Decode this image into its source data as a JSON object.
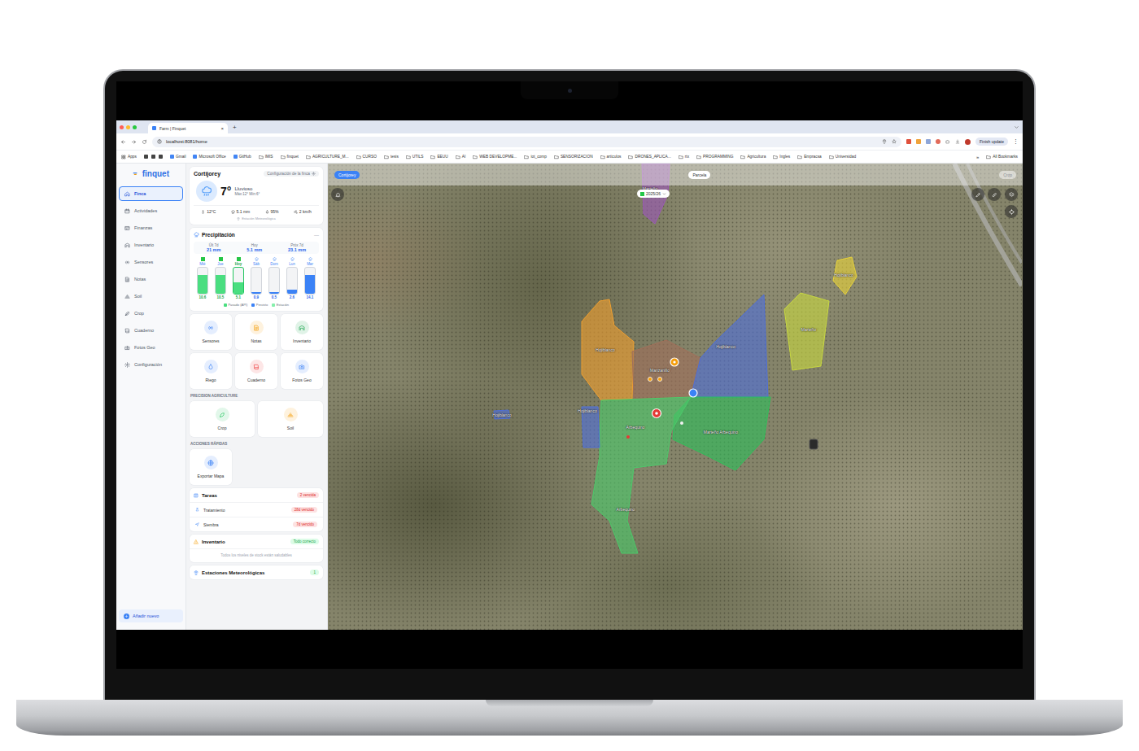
{
  "browser": {
    "tab_title": "Farm | Finquet",
    "tab_close": "×",
    "new_tab": "+",
    "url": "localhost:8081/home",
    "update_button": "Finish update",
    "menu": "⋮",
    "bookmarks": [
      {
        "label": "Apps",
        "kind": "apps"
      },
      {
        "label": "Gmail",
        "kind": "site"
      },
      {
        "label": "Microsoft Office",
        "kind": "site"
      },
      {
        "label": "GitHub",
        "kind": "site"
      },
      {
        "label": "IMIS",
        "kind": "folder"
      },
      {
        "label": "finquet",
        "kind": "folder"
      },
      {
        "label": "AGRICULTURE_M...",
        "kind": "folder"
      },
      {
        "label": "CURSO",
        "kind": "folder"
      },
      {
        "label": "tesis",
        "kind": "folder"
      },
      {
        "label": "UTILS",
        "kind": "folder"
      },
      {
        "label": "EEUU",
        "kind": "folder"
      },
      {
        "label": "AI",
        "kind": "folder"
      },
      {
        "label": "WEB DEVELOPME...",
        "kind": "folder"
      },
      {
        "label": "iot_comp",
        "kind": "folder"
      },
      {
        "label": "SENSORIZACION",
        "kind": "folder"
      },
      {
        "label": "articulos",
        "kind": "folder"
      },
      {
        "label": "DRONES_APLICA...",
        "kind": "folder"
      },
      {
        "label": "rtx",
        "kind": "folder"
      },
      {
        "label": "PROGRAMMING",
        "kind": "folder"
      },
      {
        "label": "Agricultura",
        "kind": "folder"
      },
      {
        "label": "Ingles",
        "kind": "folder"
      },
      {
        "label": "Empracsa",
        "kind": "folder"
      },
      {
        "label": "Universidad",
        "kind": "folder"
      }
    ],
    "more_bookmarks": "»",
    "all_bookmarks": "All Bookmarks"
  },
  "sidebar": {
    "logo": "finquet",
    "items": [
      {
        "label": "Finca",
        "selected": true
      },
      {
        "label": "Actividades",
        "selected": false
      },
      {
        "label": "Finanzas",
        "selected": false
      },
      {
        "label": "Inventario",
        "selected": false
      },
      {
        "label": "Sensores",
        "selected": false
      },
      {
        "label": "Notas",
        "selected": false
      },
      {
        "label": "Soil",
        "selected": false
      },
      {
        "label": "Crop",
        "selected": false
      },
      {
        "label": "Cuaderno",
        "selected": false
      },
      {
        "label": "Fotos Geo",
        "selected": false
      },
      {
        "label": "Configuración",
        "selected": false
      }
    ],
    "add_button": "Añadir nuevo"
  },
  "weather": {
    "farm": "Cortijorey",
    "settings": "Configuración de la finca",
    "temperature": "7°",
    "condition": "Lluvioso",
    "range": "Máx:12° Mín:6°",
    "stats": [
      "12°C",
      "5.1 mm",
      "95%",
      "2 km/h"
    ],
    "source": "Estación Meteorológica"
  },
  "precipitation": {
    "title": "Precipitación",
    "toggle": "—",
    "summary": [
      {
        "label": "Últ 7d",
        "value": "21 mm"
      },
      {
        "label": "Hoy",
        "value": "5.1 mm"
      },
      {
        "label": "Próx 7d",
        "value": "23.1 mm"
      }
    ],
    "bars": [
      {
        "day": "Mié",
        "value": "10.6",
        "level": 0.72,
        "kind": "past",
        "selected": false
      },
      {
        "day": "Jue",
        "value": "10.5",
        "level": 0.72,
        "kind": "past",
        "selected": false
      },
      {
        "day": "Hoy",
        "value": "5.1",
        "level": 0.45,
        "kind": "past",
        "selected": true
      },
      {
        "day": "Sáb",
        "value": "0.9",
        "level": 0.07,
        "kind": "forecast",
        "selected": false
      },
      {
        "day": "Dom",
        "value": "0.5",
        "level": 0.05,
        "kind": "forecast",
        "selected": false
      },
      {
        "day": "Lun",
        "value": "2.6",
        "level": 0.15,
        "kind": "forecast",
        "selected": false
      },
      {
        "day": "Mar",
        "value": "14.1",
        "level": 0.72,
        "kind": "forecast",
        "selected": false
      }
    ],
    "legend": [
      {
        "label": "Pasado (API)",
        "color": "#4ade80"
      },
      {
        "label": "Previsto",
        "color": "#3b82f6"
      },
      {
        "label": "Estación",
        "color": "#86efac"
      }
    ]
  },
  "quick_tiles": [
    {
      "label": "Sensores",
      "color": "#3b82f6"
    },
    {
      "label": "Notas",
      "color": "#f59e0b"
    },
    {
      "label": "Inventario",
      "color": "#16a34a"
    },
    {
      "label": "Riego",
      "color": "#3b82f6"
    },
    {
      "label": "Cuaderno",
      "color": "#ef4444"
    },
    {
      "label": "Fotos Geo",
      "color": "#3b82f6"
    }
  ],
  "precision": {
    "title": "PRECISION AGRICULTURE",
    "tiles": [
      {
        "label": "Crop",
        "color": "#22c55e"
      },
      {
        "label": "Soil",
        "color": "#f59e0b"
      }
    ]
  },
  "actions": {
    "title": "ACCIONES RÁPIDAS",
    "tiles": [
      {
        "label": "Exportar Mapa",
        "color": "#3b82f6"
      }
    ]
  },
  "tasks": {
    "title": "Tareas",
    "badge": "2 vencida",
    "rows": [
      {
        "label": "Tratamiento",
        "status": "28d vencido"
      },
      {
        "label": "Siembra",
        "status": "7d vencido"
      }
    ]
  },
  "inventory": {
    "title": "Inventario",
    "badge": "Todo correcto",
    "message": "Todos los niveles de stock están saludables"
  },
  "stations": {
    "title": "Estaciones Meteorológicas",
    "count": "1"
  },
  "map": {
    "farm_pill": "Cortijorey",
    "mode": "Parcela",
    "season": "2025/26",
    "layer": "Crop",
    "parcels": [
      {
        "name": "Marteño",
        "color": "#9b59b6"
      },
      {
        "name": "Hojiblanco",
        "color": "#f0a030"
      },
      {
        "name": "Manzanillo",
        "color": "#a0705a"
      },
      {
        "name": "Hojiblanco",
        "color": "#4f6fd8"
      },
      {
        "name": "Marteño Arbequino",
        "color": "#2fbf5a"
      },
      {
        "name": "Arbequino",
        "color": "#4cc96a"
      },
      {
        "name": "Hojiblanco",
        "color": "#4f6fd8"
      },
      {
        "name": "Marteño",
        "color": "#c8d840"
      },
      {
        "name": "Hojiblanco",
        "color": "#e6d23a"
      },
      {
        "name": "Hojiblanco",
        "color": "#4f6fd8"
      }
    ]
  }
}
